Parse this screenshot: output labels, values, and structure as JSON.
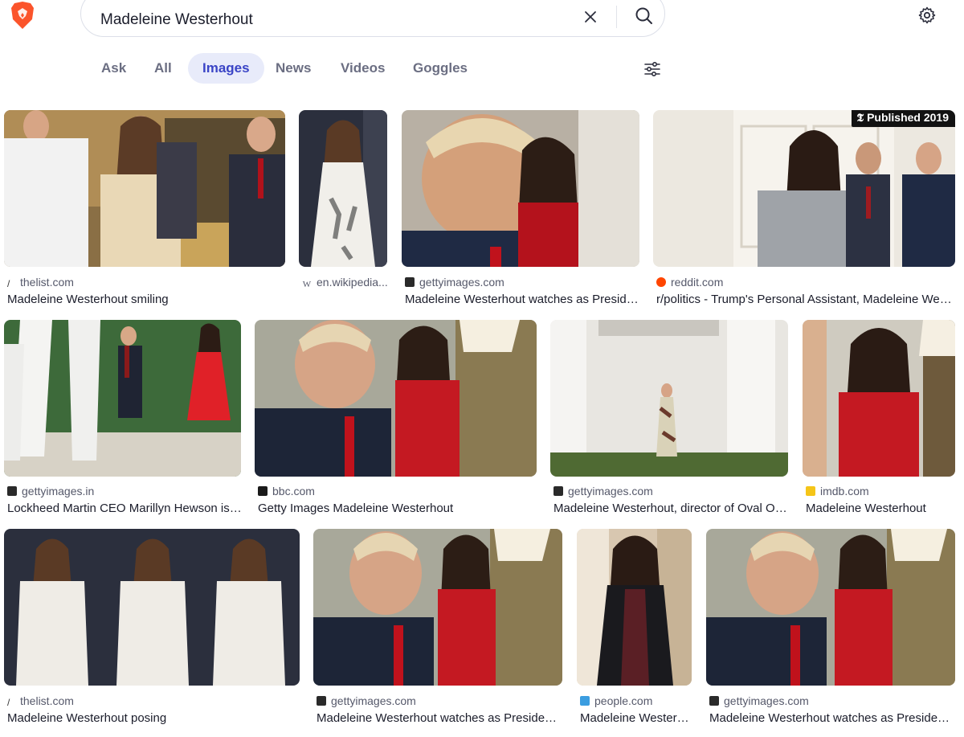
{
  "search": {
    "query": "Madeleine Westerhout"
  },
  "tabs": [
    {
      "label": "Ask"
    },
    {
      "label": "All"
    },
    {
      "label": "Images"
    },
    {
      "label": "News"
    },
    {
      "label": "Videos"
    },
    {
      "label": "Goggles"
    }
  ],
  "results": [
    {
      "source": "thelist.com",
      "caption": "Madeleine Westerhout smiling"
    },
    {
      "source": "en.wikipedia...",
      "caption": ""
    },
    {
      "source": "gettyimages.com",
      "caption": "Madeleine Westerhout watches as President ..."
    },
    {
      "source": "reddit.com",
      "caption": "r/politics - Trump's Personal Assistant, Madeleine Westerh...",
      "badge": "Published 2019"
    },
    {
      "source": "gettyimages.in",
      "caption": "Lockheed Martin CEO Marillyn Hewson is esc..."
    },
    {
      "source": "bbc.com",
      "caption": "Getty Images Madeleine Westerhout"
    },
    {
      "source": "gettyimages.com",
      "caption": "Madeleine Westerhout, director of Oval Offic..."
    },
    {
      "source": "imdb.com",
      "caption": "Madeleine Westerhout"
    },
    {
      "source": "thelist.com",
      "caption": "Madeleine Westerhout posing"
    },
    {
      "source": "gettyimages.com",
      "caption": "Madeleine Westerhout watches as President Do..."
    },
    {
      "source": "people.com",
      "caption": "Madeleine Westerhout"
    },
    {
      "source": "gettyimages.com",
      "caption": "Madeleine Westerhout watches as President Do..."
    }
  ],
  "colors": {
    "accent": "#3a44c6",
    "active_tab_bg": "#e8ebfa",
    "brand": "#fb542b"
  }
}
